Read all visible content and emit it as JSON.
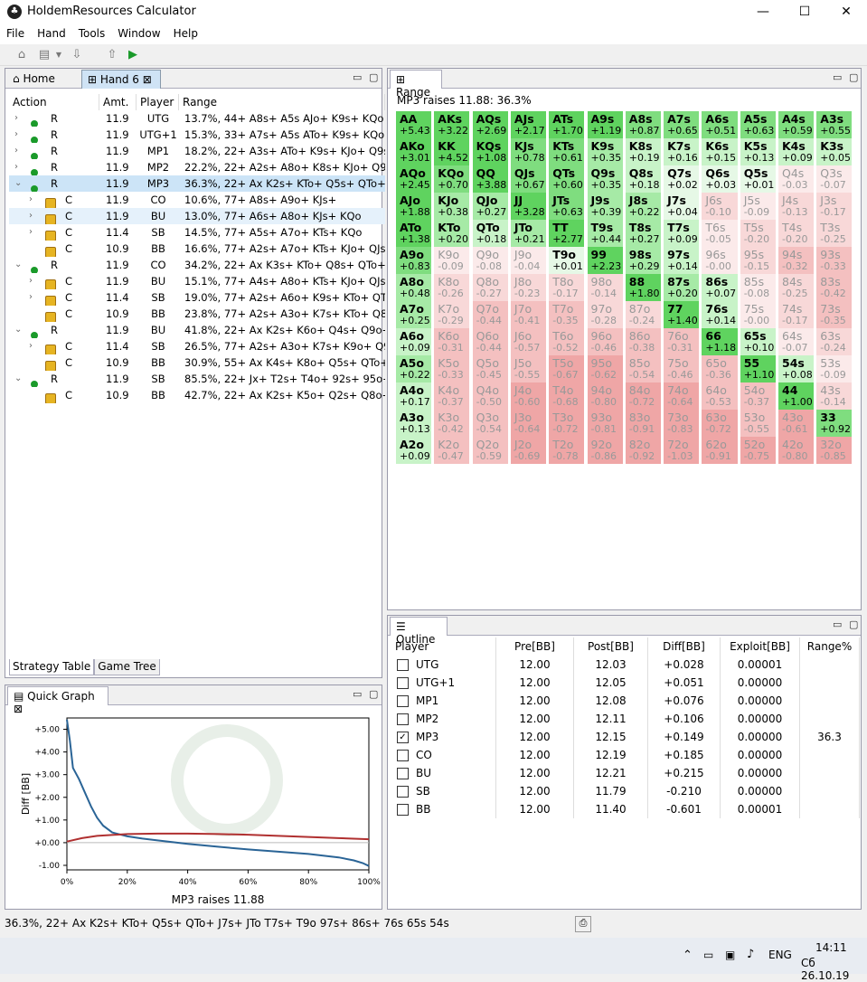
{
  "window": {
    "title": "HoldemResources Calculator"
  },
  "menu": [
    "File",
    "Hand",
    "Tools",
    "Window",
    "Help"
  ],
  "tabs": {
    "home": "Home",
    "hand": "Hand 6",
    "range": "Range",
    "outline": "Outline",
    "quick_graph": "Quick Graph"
  },
  "strategy": {
    "headers": [
      "Action",
      "Amt.",
      "Player",
      "Range"
    ],
    "rows": [
      {
        "indent": 0,
        "exp": ">",
        "icon": "dot",
        "action": "R",
        "amt": "11.9",
        "player": "UTG",
        "range": "13.7%, 44+ A8s+ A5s AJo+ K9s+ KQo Q9s+"
      },
      {
        "indent": 0,
        "exp": ">",
        "icon": "dot",
        "action": "R",
        "amt": "11.9",
        "player": "UTG+1",
        "range": "15.3%, 33+ A7s+ A5s ATo+ K9s+ KQo Q9s"
      },
      {
        "indent": 0,
        "exp": ">",
        "icon": "dot",
        "action": "R",
        "amt": "11.9",
        "player": "MP1",
        "range": "18.2%, 22+ A3s+ ATo+ K9s+ KJo+ Q9s+ J9"
      },
      {
        "indent": 0,
        "exp": ">",
        "icon": "dot",
        "action": "R",
        "amt": "11.9",
        "player": "MP2",
        "range": "22.2%, 22+ A2s+ A8o+ K8s+ KJo+ Q9s+ Q"
      },
      {
        "indent": 0,
        "exp": "v",
        "icon": "dot",
        "action": "R",
        "amt": "11.9",
        "player": "MP3",
        "range": "36.3%, 22+ Ax K2s+ KTo+ Q5s+ QTo+ J7s+",
        "state": "sel"
      },
      {
        "indent": 1,
        "exp": ">",
        "icon": "lock",
        "action": "C",
        "amt": "11.9",
        "player": "CO",
        "range": "10.6%, 77+ A8s+ A9o+ KJs+"
      },
      {
        "indent": 1,
        "exp": ">",
        "icon": "lock",
        "action": "C",
        "amt": "11.9",
        "player": "BU",
        "range": "13.0%, 77+ A6s+ A8o+ KJs+ KQo",
        "state": "hl"
      },
      {
        "indent": 1,
        "exp": ">",
        "icon": "lock",
        "action": "C",
        "amt": "11.4",
        "player": "SB",
        "range": "14.5%, 77+ A5s+ A7o+ KTs+ KQo"
      },
      {
        "indent": 1,
        "exp": "",
        "icon": "lock",
        "action": "C",
        "amt": "10.9",
        "player": "BB",
        "range": "16.6%, 77+ A2s+ A7o+ KTs+ KJo+ QJs"
      },
      {
        "indent": 0,
        "exp": "v",
        "icon": "dot",
        "action": "R",
        "amt": "11.9",
        "player": "CO",
        "range": "34.2%, 22+ Ax K3s+ KTo+ Q8s+ QTo+ J7s+"
      },
      {
        "indent": 1,
        "exp": ">",
        "icon": "lock",
        "action": "C",
        "amt": "11.9",
        "player": "BU",
        "range": "15.1%, 77+ A4s+ A8o+ KTs+ KJo+ QJs"
      },
      {
        "indent": 1,
        "exp": ">",
        "icon": "lock",
        "action": "C",
        "amt": "11.4",
        "player": "SB",
        "range": "19.0%, 77+ A2s+ A6o+ K9s+ KTo+ QTs+"
      },
      {
        "indent": 1,
        "exp": "",
        "icon": "lock",
        "action": "C",
        "amt": "10.9",
        "player": "BB",
        "range": "23.8%, 77+ A2s+ A3o+ K7s+ KTo+ Q8s+ Q"
      },
      {
        "indent": 0,
        "exp": "v",
        "icon": "dot",
        "action": "R",
        "amt": "11.9",
        "player": "BU",
        "range": "41.8%, 22+ Ax K2s+ K6o+ Q4s+ Q9o+ J7s+"
      },
      {
        "indent": 1,
        "exp": ">",
        "icon": "lock",
        "action": "C",
        "amt": "11.4",
        "player": "SB",
        "range": "26.5%, 77+ A2s+ A3o+ K7s+ K9o+ Q9s+ Q"
      },
      {
        "indent": 1,
        "exp": "",
        "icon": "lock",
        "action": "C",
        "amt": "10.9",
        "player": "BB",
        "range": "30.9%, 55+ Ax K4s+ K8o+ Q5s+ QTo+ J9s+"
      },
      {
        "indent": 0,
        "exp": "v",
        "icon": "dot",
        "action": "R",
        "amt": "11.9",
        "player": "SB",
        "range": "85.5%, 22+ Jx+ T2s+ T4o+ 92s+ 95o+ 82s+"
      },
      {
        "indent": 1,
        "exp": "",
        "icon": "lock",
        "action": "C",
        "amt": "10.9",
        "player": "BB",
        "range": "42.7%, 22+ Ax K2s+ K5o+ Q2s+ Q8o+ J7s+"
      }
    ],
    "bottom_tabs": [
      "Strategy Table",
      "Game Tree"
    ]
  },
  "range": {
    "title": "MP3 raises 11.88: 36.3%",
    "cells": [
      [
        "AA",
        "+5.43"
      ],
      [
        "AKs",
        "+3.22"
      ],
      [
        "AQs",
        "+2.69"
      ],
      [
        "AJs",
        "+2.17"
      ],
      [
        "ATs",
        "+1.70"
      ],
      [
        "A9s",
        "+1.19"
      ],
      [
        "A8s",
        "+0.87"
      ],
      [
        "A7s",
        "+0.65"
      ],
      [
        "A6s",
        "+0.51"
      ],
      [
        "A5s",
        "+0.63"
      ],
      [
        "A4s",
        "+0.59"
      ],
      [
        "A3s",
        "+0.55"
      ],
      [
        "AKo",
        "+3.01"
      ],
      [
        "KK",
        "+4.52"
      ],
      [
        "KQs",
        "+1.08"
      ],
      [
        "KJs",
        "+0.78"
      ],
      [
        "KTs",
        "+0.61"
      ],
      [
        "K9s",
        "+0.35"
      ],
      [
        "K8s",
        "+0.19"
      ],
      [
        "K7s",
        "+0.16"
      ],
      [
        "K6s",
        "+0.15"
      ],
      [
        "K5s",
        "+0.13"
      ],
      [
        "K4s",
        "+0.09"
      ],
      [
        "K3s",
        "+0.05"
      ],
      [
        "AQo",
        "+2.45"
      ],
      [
        "KQo",
        "+0.70"
      ],
      [
        "QQ",
        "+3.88"
      ],
      [
        "QJs",
        "+0.67"
      ],
      [
        "QTs",
        "+0.60"
      ],
      [
        "Q9s",
        "+0.35"
      ],
      [
        "Q8s",
        "+0.18"
      ],
      [
        "Q7s",
        "+0.02"
      ],
      [
        "Q6s",
        "+0.03"
      ],
      [
        "Q5s",
        "+0.01"
      ],
      [
        "Q4s",
        "-0.03"
      ],
      [
        "Q3s",
        "-0.07"
      ],
      [
        "AJo",
        "+1.88"
      ],
      [
        "KJo",
        "+0.38"
      ],
      [
        "QJo",
        "+0.27"
      ],
      [
        "JJ",
        "+3.28"
      ],
      [
        "JTs",
        "+0.63"
      ],
      [
        "J9s",
        "+0.39"
      ],
      [
        "J8s",
        "+0.22"
      ],
      [
        "J7s",
        "+0.04"
      ],
      [
        "J6s",
        "-0.10"
      ],
      [
        "J5s",
        "-0.09"
      ],
      [
        "J4s",
        "-0.13"
      ],
      [
        "J3s",
        "-0.17"
      ],
      [
        "ATo",
        "+1.38"
      ],
      [
        "KTo",
        "+0.20"
      ],
      [
        "QTo",
        "+0.18"
      ],
      [
        "JTo",
        "+0.21"
      ],
      [
        "TT",
        "+2.77"
      ],
      [
        "T9s",
        "+0.44"
      ],
      [
        "T8s",
        "+0.27"
      ],
      [
        "T7s",
        "+0.09"
      ],
      [
        "T6s",
        "-0.05"
      ],
      [
        "T5s",
        "-0.20"
      ],
      [
        "T4s",
        "-0.20"
      ],
      [
        "T3s",
        "-0.25"
      ],
      [
        "A9o",
        "+0.83"
      ],
      [
        "K9o",
        "-0.09"
      ],
      [
        "Q9o",
        "-0.08"
      ],
      [
        "J9o",
        "-0.04"
      ],
      [
        "T9o",
        "+0.01"
      ],
      [
        "99",
        "+2.23"
      ],
      [
        "98s",
        "+0.29"
      ],
      [
        "97s",
        "+0.14"
      ],
      [
        "96s",
        "-0.00"
      ],
      [
        "95s",
        "-0.15"
      ],
      [
        "94s",
        "-0.32"
      ],
      [
        "93s",
        "-0.33"
      ],
      [
        "A8o",
        "+0.48"
      ],
      [
        "K8o",
        "-0.26"
      ],
      [
        "Q8o",
        "-0.27"
      ],
      [
        "J8o",
        "-0.23"
      ],
      [
        "T8o",
        "-0.17"
      ],
      [
        "98o",
        "-0.14"
      ],
      [
        "88",
        "+1.80"
      ],
      [
        "87s",
        "+0.20"
      ],
      [
        "86s",
        "+0.07"
      ],
      [
        "85s",
        "-0.08"
      ],
      [
        "84s",
        "-0.25"
      ],
      [
        "83s",
        "-0.42"
      ],
      [
        "A7o",
        "+0.25"
      ],
      [
        "K7o",
        "-0.29"
      ],
      [
        "Q7o",
        "-0.44"
      ],
      [
        "J7o",
        "-0.41"
      ],
      [
        "T7o",
        "-0.35"
      ],
      [
        "97o",
        "-0.28"
      ],
      [
        "87o",
        "-0.24"
      ],
      [
        "77",
        "+1.40"
      ],
      [
        "76s",
        "+0.14"
      ],
      [
        "75s",
        "-0.00"
      ],
      [
        "74s",
        "-0.17"
      ],
      [
        "73s",
        "-0.35"
      ],
      [
        "A6o",
        "+0.09"
      ],
      [
        "K6o",
        "-0.31"
      ],
      [
        "Q6o",
        "-0.44"
      ],
      [
        "J6o",
        "-0.57"
      ],
      [
        "T6o",
        "-0.52"
      ],
      [
        "96o",
        "-0.46"
      ],
      [
        "86o",
        "-0.38"
      ],
      [
        "76o",
        "-0.31"
      ],
      [
        "66",
        "+1.18"
      ],
      [
        "65s",
        "+0.10"
      ],
      [
        "64s",
        "-0.07"
      ],
      [
        "63s",
        "-0.24"
      ],
      [
        "A5o",
        "+0.22"
      ],
      [
        "K5o",
        "-0.33"
      ],
      [
        "Q5o",
        "-0.45"
      ],
      [
        "J5o",
        "-0.55"
      ],
      [
        "T5o",
        "-0.67"
      ],
      [
        "95o",
        "-0.62"
      ],
      [
        "85o",
        "-0.54"
      ],
      [
        "75o",
        "-0.46"
      ],
      [
        "65o",
        "-0.36"
      ],
      [
        "55",
        "+1.10"
      ],
      [
        "54s",
        "+0.08"
      ],
      [
        "53s",
        "-0.09"
      ],
      [
        "A4o",
        "+0.17"
      ],
      [
        "K4o",
        "-0.37"
      ],
      [
        "Q4o",
        "-0.50"
      ],
      [
        "J4o",
        "-0.60"
      ],
      [
        "T4o",
        "-0.68"
      ],
      [
        "94o",
        "-0.80"
      ],
      [
        "84o",
        "-0.72"
      ],
      [
        "74o",
        "-0.64"
      ],
      [
        "64o",
        "-0.53"
      ],
      [
        "54o",
        "-0.37"
      ],
      [
        "44",
        "+1.00"
      ],
      [
        "43s",
        "-0.14"
      ],
      [
        "A3o",
        "+0.13"
      ],
      [
        "K3o",
        "-0.42"
      ],
      [
        "Q3o",
        "-0.54"
      ],
      [
        "J3o",
        "-0.64"
      ],
      [
        "T3o",
        "-0.72"
      ],
      [
        "93o",
        "-0.81"
      ],
      [
        "83o",
        "-0.91"
      ],
      [
        "73o",
        "-0.83"
      ],
      [
        "63o",
        "-0.72"
      ],
      [
        "53o",
        "-0.55"
      ],
      [
        "43o",
        "-0.61"
      ],
      [
        "33",
        "+0.92"
      ],
      [
        "A2o",
        "+0.09"
      ],
      [
        "K2o",
        "-0.47"
      ],
      [
        "Q2o",
        "-0.59"
      ],
      [
        "J2o",
        "-0.69"
      ],
      [
        "T2o",
        "-0.78"
      ],
      [
        "92o",
        "-0.86"
      ],
      [
        "82o",
        "-0.92"
      ],
      [
        "72o",
        "-1.03"
      ],
      [
        "62o",
        "-0.91"
      ],
      [
        "52o",
        "-0.75"
      ],
      [
        "42o",
        "-0.80"
      ],
      [
        "32o",
        "-0.85"
      ]
    ]
  },
  "outline": {
    "headers": [
      "Player",
      "Pre[BB]",
      "Post[BB]",
      "Diff[BB]",
      "Exploit[BB]",
      "Range%"
    ],
    "rows": [
      {
        "checked": false,
        "player": "UTG",
        "pre": "12.00",
        "post": "12.03",
        "diff": "+0.028",
        "exploit": "0.00001",
        "range": ""
      },
      {
        "checked": false,
        "player": "UTG+1",
        "pre": "12.00",
        "post": "12.05",
        "diff": "+0.051",
        "exploit": "0.00000",
        "range": ""
      },
      {
        "checked": false,
        "player": "MP1",
        "pre": "12.00",
        "post": "12.08",
        "diff": "+0.076",
        "exploit": "0.00000",
        "range": ""
      },
      {
        "checked": false,
        "player": "MP2",
        "pre": "12.00",
        "post": "12.11",
        "diff": "+0.106",
        "exploit": "0.00000",
        "range": ""
      },
      {
        "checked": true,
        "player": "MP3",
        "pre": "12.00",
        "post": "12.15",
        "diff": "+0.149",
        "exploit": "0.00000",
        "range": "36.3"
      },
      {
        "checked": false,
        "player": "CO",
        "pre": "12.00",
        "post": "12.19",
        "diff": "+0.185",
        "exploit": "0.00000",
        "range": ""
      },
      {
        "checked": false,
        "player": "BU",
        "pre": "12.00",
        "post": "12.21",
        "diff": "+0.215",
        "exploit": "0.00000",
        "range": ""
      },
      {
        "checked": false,
        "player": "SB",
        "pre": "12.00",
        "post": "11.79",
        "diff": "-0.210",
        "exploit": "0.00000",
        "range": ""
      },
      {
        "checked": false,
        "player": "BB",
        "pre": "12.00",
        "post": "11.40",
        "diff": "-0.601",
        "exploit": "0.00001",
        "range": ""
      }
    ]
  },
  "chart_data": {
    "type": "line",
    "xlabel": "MP3 raises 11.88",
    "ylabel": "Diff [BB]",
    "xlim": [
      0,
      100
    ],
    "ylim": [
      -1.2,
      5.5
    ],
    "x_ticks": [
      "0%",
      "20%",
      "40%",
      "60%",
      "80%",
      "100%"
    ],
    "y_ticks": [
      "+5.00",
      "+4.00",
      "+3.00",
      "+2.00",
      "+1.00",
      "+0.00",
      "-1.00"
    ],
    "series": [
      {
        "color": "#2a6496",
        "x": [
          0,
          1,
          2,
          4,
          6,
          8,
          10,
          12,
          15,
          20,
          25,
          30,
          40,
          50,
          60,
          70,
          80,
          90,
          95,
          98,
          100
        ],
        "y": [
          5.43,
          4.5,
          3.3,
          2.8,
          2.2,
          1.6,
          1.1,
          0.75,
          0.45,
          0.28,
          0.18,
          0.1,
          -0.05,
          -0.18,
          -0.3,
          -0.4,
          -0.5,
          -0.65,
          -0.78,
          -0.9,
          -1.03
        ]
      },
      {
        "color": "#b03030",
        "x": [
          0,
          5,
          10,
          20,
          30,
          40,
          50,
          60,
          70,
          80,
          90,
          100
        ],
        "y": [
          0.05,
          0.2,
          0.3,
          0.38,
          0.4,
          0.4,
          0.38,
          0.35,
          0.3,
          0.25,
          0.2,
          0.15
        ]
      }
    ]
  },
  "status": {
    "text": "36.3%, 22+ Ax K2s+ KTo+ Q5s+ QTo+ J7s+ JTo T7s+ T9o 97s+ 86s+ 76s 65s 54s"
  },
  "taskbar": {
    "lang": "ENG",
    "time": "14:11",
    "date": "Сб 26.10.19"
  },
  "colors": {
    "pos_strong": "#5fd35f",
    "pos_weak": "#d9f7d9",
    "neg_weak": "#fbe6e6",
    "neg_strong": "#ef9f9f"
  }
}
